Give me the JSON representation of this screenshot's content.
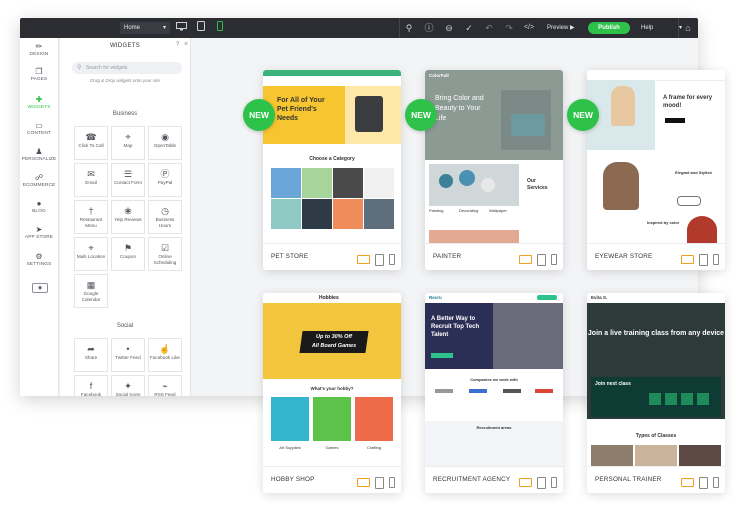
{
  "topbar": {
    "page_select": "Home",
    "preview": "Preview",
    "publish": "Publish",
    "help": "Help"
  },
  "leftnav": [
    {
      "label": "DESIGN",
      "icon": "brush-icon"
    },
    {
      "label": "PAGES",
      "icon": "pages-icon"
    },
    {
      "label": "WIDGETS",
      "icon": "plus-icon"
    },
    {
      "label": "CONTENT",
      "icon": "folder-icon"
    },
    {
      "label": "PERSONALIZE",
      "icon": "person-icon"
    },
    {
      "label": "ECOMMERCE",
      "icon": "cart-icon"
    },
    {
      "label": "BLOG",
      "icon": "chat-icon"
    },
    {
      "label": "APP STORE",
      "icon": "rocket-icon"
    },
    {
      "label": "SETTINGS",
      "icon": "gear-icon"
    }
  ],
  "widgets_panel": {
    "title": "WIDGETS",
    "search_placeholder": "Search for widgets",
    "hint": "Drag & Drop widgets onto your site",
    "business_title": "Business",
    "business": [
      {
        "label": "Click To Call",
        "icon": "phone-icon"
      },
      {
        "label": "Map",
        "icon": "pin-icon"
      },
      {
        "label": "OpenTable",
        "icon": "opentable-icon"
      },
      {
        "label": "Email",
        "icon": "envelope-icon"
      },
      {
        "label": "Contact Form",
        "icon": "form-icon"
      },
      {
        "label": "PayPal",
        "icon": "paypal-icon"
      },
      {
        "label": "Restaurant Menu",
        "icon": "fork-knife-icon"
      },
      {
        "label": "Yelp Reviews",
        "icon": "yelp-icon"
      },
      {
        "label": "Business Hours",
        "icon": "clock-icon"
      },
      {
        "label": "Multi Location",
        "icon": "multi-pin-icon"
      },
      {
        "label": "Coupon",
        "icon": "tag-icon"
      },
      {
        "label": "Online Scheduling",
        "icon": "calendar-check-icon"
      },
      {
        "label": "Google Calendar",
        "icon": "calendar-icon"
      }
    ],
    "social_title": "Social",
    "social": [
      {
        "label": "Share",
        "icon": "share-icon"
      },
      {
        "label": "Twitter Feed",
        "icon": "twitter-icon"
      },
      {
        "label": "Facebook Like",
        "icon": "thumbs-up-icon"
      },
      {
        "label": "Facebook Comments",
        "icon": "facebook-icon"
      },
      {
        "label": "Social Icons",
        "icon": "social-icon"
      },
      {
        "label": "RSS Feed",
        "icon": "rss-icon"
      }
    ]
  },
  "new_badge": "NEW",
  "templates": [
    {
      "name": "PET STORE",
      "is_new": true
    },
    {
      "name": "PAINTER",
      "is_new": true
    },
    {
      "name": "EYEWEAR STORE",
      "is_new": true
    },
    {
      "name": "HOBBY SHOP",
      "is_new": false
    },
    {
      "name": "RECRUITMENT AGENCY",
      "is_new": false
    },
    {
      "name": "PERSONAL TRAINER",
      "is_new": false
    }
  ],
  "thumb_text": {
    "pet_headline": "For All of Your Pet Friend's Needs",
    "pet_category": "Choose a Category",
    "painter_brand": "ColorFull",
    "painter_headline": "Bring Color and Beauty to Your Life",
    "painter_services": "Our Services",
    "painter_items": [
      "Painting",
      "Decorating",
      "Wallpaper"
    ],
    "eyewear_headline": "A frame for every mood!",
    "eyewear_stylish": "Elegant and Stylish",
    "eyewear_inspired": "Inspired by color",
    "hobby_brand": "Hobbies",
    "hobby_promo_1": "Up to 30% Off",
    "hobby_promo_2": "All Board Games",
    "hobby_question": "What's your hobby?",
    "hobby_items": [
      "Art Supplies",
      "Games",
      "Crafting"
    ],
    "recruit_brand": "Recru",
    "recruit_headline": "A Better Way to Recruit Top Tech Talent",
    "recruit_companies": "Companies we work with",
    "recruit_areas": "Recruitment areas",
    "trainer_brand": "Evita S.",
    "trainer_headline": "Join a live training class from any device",
    "trainer_next": "Join next class",
    "trainer_types": "Types of Classes"
  },
  "colors": {
    "accent": "#2ec24a",
    "topbar": "#2b2d33"
  }
}
